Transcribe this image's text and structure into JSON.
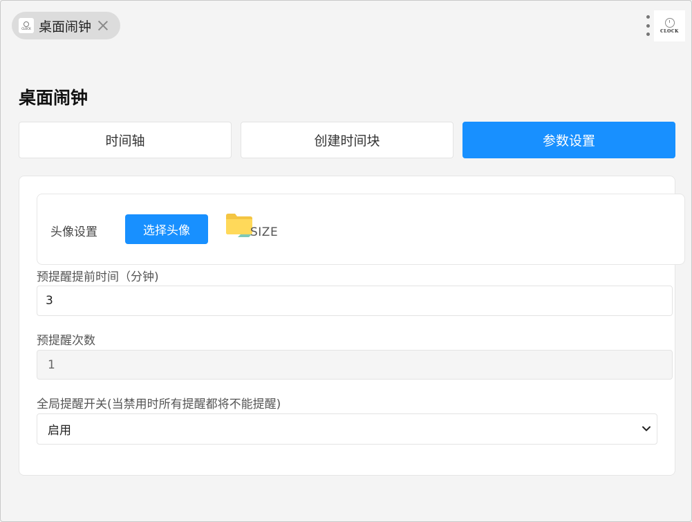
{
  "tab": {
    "title": "桌面闹钟",
    "favicon_text": "CLOCK",
    "close_icon": "close-icon"
  },
  "header": {
    "menu_icon": "more-vertical-icon",
    "logo_text": "CLOCK"
  },
  "page": {
    "title": "桌面闹钟"
  },
  "nav_tabs": [
    {
      "label": "时间轴",
      "active": false
    },
    {
      "label": "创建时间块",
      "active": false
    },
    {
      "label": "参数设置",
      "active": true
    }
  ],
  "settings": {
    "avatar": {
      "label": "头像设置",
      "button_label": "选择头像",
      "preview_icon": "folder-icon",
      "preview_text": "SIZE"
    },
    "advance_minutes": {
      "label": "预提醒提前时间（分钟)",
      "value": "3"
    },
    "reminder_count": {
      "label": "预提醒次数",
      "value": "1"
    },
    "global_switch": {
      "label": "全局提醒开关(当禁用时所有提醒都将不能提醒)",
      "selected": "启用"
    }
  },
  "colors": {
    "accent": "#1890ff",
    "background": "#f4f4f4",
    "panel": "#ffffff"
  }
}
